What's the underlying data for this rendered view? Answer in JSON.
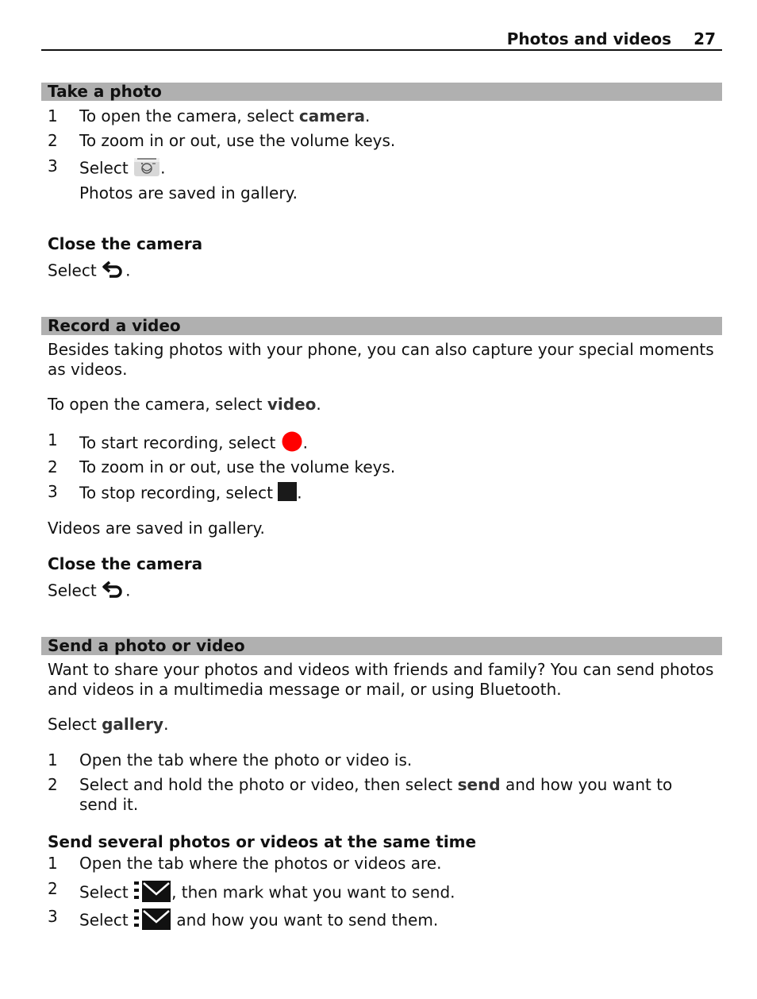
{
  "header": {
    "title": "Photos and videos",
    "page": "27"
  },
  "take_photo": {
    "heading": "Take a photo",
    "steps": [
      {
        "n": "1",
        "pre": "To open the camera, select ",
        "bold": "camera",
        "post": "."
      },
      {
        "n": "2",
        "text": "To zoom in or out, use the volume keys."
      },
      {
        "n": "3",
        "pre": "Select ",
        "icon": "camera-shutter-icon",
        "post": "."
      }
    ],
    "note": "Photos are saved in gallery.",
    "close": {
      "heading": "Close the camera",
      "pre": "Select ",
      "icon": "back-arrow-icon",
      "post": "."
    }
  },
  "record_video": {
    "heading": "Record a video",
    "intro": "Besides taking photos with your phone, you can also capture your special moments as videos.",
    "open": {
      "pre": "To open the camera, select ",
      "bold": "video",
      "post": "."
    },
    "steps": [
      {
        "n": "1",
        "pre": "To start recording, select ",
        "icon": "record-icon",
        "post": "."
      },
      {
        "n": "2",
        "text": "To zoom in or out, use the volume keys."
      },
      {
        "n": "3",
        "pre": "To stop recording, select ",
        "icon": "stop-icon",
        "post": "."
      }
    ],
    "note": "Videos are saved in gallery.",
    "close": {
      "heading": "Close the camera",
      "pre": "Select ",
      "icon": "back-arrow-icon",
      "post": "."
    }
  },
  "send": {
    "heading": "Send a photo or video",
    "intro": "Want to share your photos and videos with friends and family? You can send photos and videos in a multimedia message or mail, or using Bluetooth.",
    "select": {
      "pre": "Select ",
      "bold": "gallery",
      "post": "."
    },
    "steps": [
      {
        "n": "1",
        "text": "Open the tab where the photo or video is."
      },
      {
        "n": "2",
        "pre": "Select and hold the photo or video, then select ",
        "bold": "send",
        "post": " and how you want to send it."
      }
    ],
    "several": {
      "heading": "Send several photos or videos at the same time",
      "steps": [
        {
          "n": "1",
          "text": "Open the tab where the photos or videos are."
        },
        {
          "n": "2",
          "pre": "Select ",
          "icon": "send-mail-icon",
          "post": ", then mark what you want to send."
        },
        {
          "n": "3",
          "pre": "Select ",
          "icon": "send-mail-icon",
          "post": " and how you want to send them."
        }
      ]
    }
  },
  "colors": {
    "section_bar": "#b0b0b0",
    "record": "#ff0000",
    "stop": "#1a1a1a"
  }
}
